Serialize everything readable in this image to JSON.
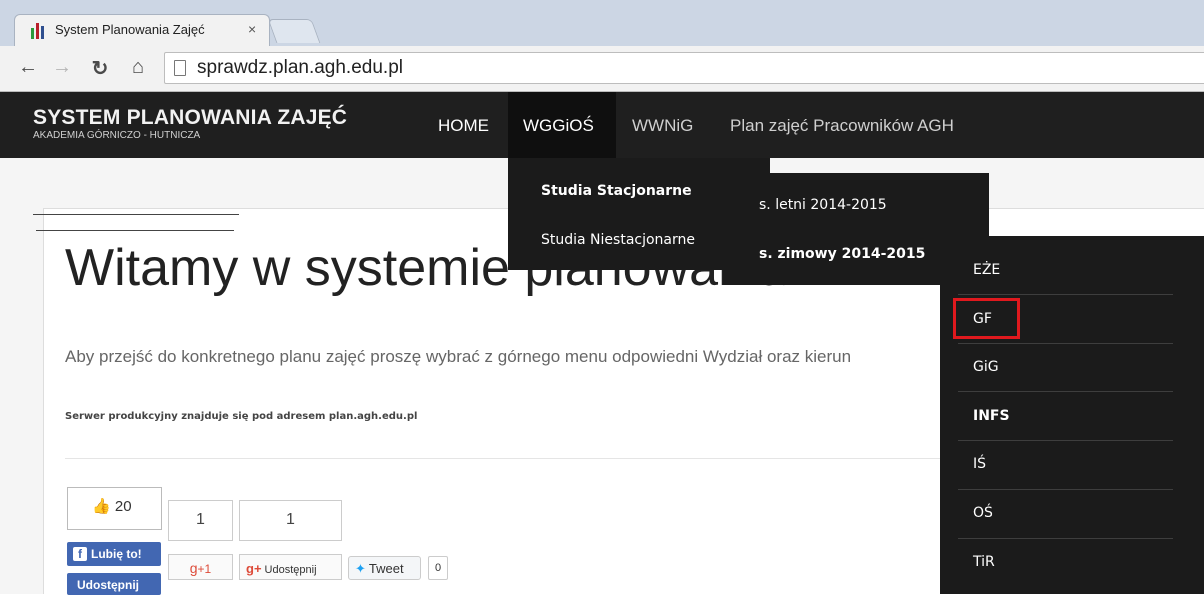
{
  "browser": {
    "tab_title": "System Planowania Zajęć",
    "tab_close": "×",
    "url": "sprawdz.plan.agh.edu.pl",
    "icons": [
      "back-icon",
      "forward-icon",
      "reload-icon",
      "home-icon",
      "page-icon"
    ]
  },
  "header": {
    "brand_title": "SYSTEM PLANOWANIA ZAJĘĆ",
    "brand_subtitle": "AKADEMIA GÓRNICZO - HUTNICZA",
    "menu": [
      "HOME",
      "WGGiOŚ",
      "WWNiG",
      "Plan zajęć Pracowników AGH"
    ],
    "active_menu": "WGGiOŚ"
  },
  "dropdown_level1": [
    "Studia Stacjonarne",
    "Studia Niestacjonarne"
  ],
  "dropdown_level2": [
    "s. letni 2014-2015",
    "s. zimowy 2014-2015"
  ],
  "dropdown_level3": [
    "EŻE",
    "GF",
    "GiG",
    "INFS",
    "IŚ",
    "OŚ",
    "TiR"
  ],
  "highlighted_item": "GF",
  "main": {
    "hero_title": "Witamy w systemie planowania z",
    "lead": "Aby przejść do konkretnego planu zajęć proszę wybrać z górnego menu odpowiedni Wydział oraz kierun",
    "note": "Serwer produkcyjny znajduje się pod adresem plan.agh.edu.pl"
  },
  "social": {
    "fb_count": "20",
    "fb_like": "Lubię to!",
    "fb_share": "Udostępnij",
    "gplus_count": "1",
    "gplus_share_count": "1",
    "gplus_button": "+1",
    "gplus_share": "Udostępnij",
    "tweet": "Tweet",
    "tweet_count": "0"
  },
  "colors": {
    "nav_bg": "#1f1f1f",
    "dropdown_bg": "#1b1b1b",
    "highlight": "#e0191e",
    "facebook": "#4267b2"
  }
}
